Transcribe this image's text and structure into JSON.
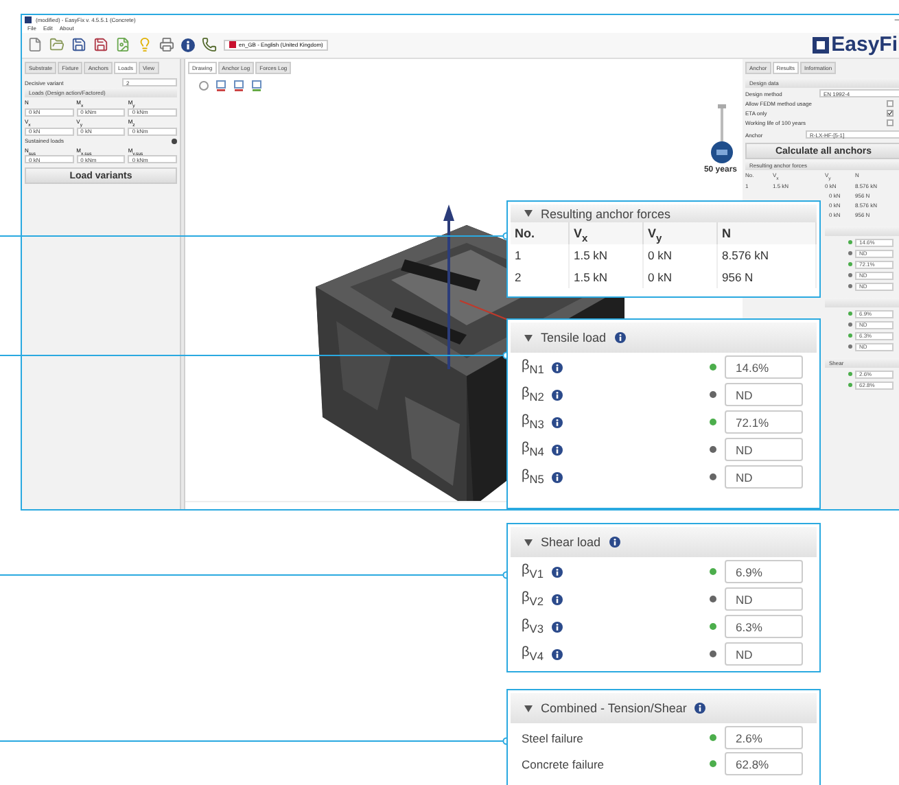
{
  "app": {
    "title": "(modified) - EasyFix v. 4.5.5.1 (Concrete)",
    "menu": [
      "File",
      "Edit",
      "About"
    ],
    "language": "en_GB - English (United Kingdom)",
    "logo": "EasyFi"
  },
  "left_panel": {
    "tabs": [
      {
        "label": "Substrate",
        "selected": false
      },
      {
        "label": "Fixture",
        "selected": false
      },
      {
        "label": "Anchors",
        "selected": false
      },
      {
        "label": "Loads",
        "selected": true
      },
      {
        "label": "View",
        "selected": false
      }
    ],
    "variant": {
      "label": "Decisive variant",
      "value": "2"
    },
    "section": "Loads (Design action/Factored)",
    "groups": [
      {
        "fields": [
          {
            "label": "N",
            "value": "0 kN"
          },
          {
            "label": "M$_{x}$",
            "value": "0 kNm"
          },
          {
            "label": "M$_{y}$",
            "value": "0 kNm"
          }
        ]
      },
      {
        "fields": [
          {
            "label": "V$_{x}$",
            "value": "0 kN"
          },
          {
            "label": "V$_{y}$",
            "value": "0 kN"
          },
          {
            "label": "M$_{z}$",
            "value": "0 kNm"
          }
        ]
      }
    ],
    "sustained": {
      "label": "Sustained loads",
      "fields": [
        {
          "label": "N$_{sus}$",
          "value": "0 kN"
        },
        {
          "label": "M$_{x,sus}$",
          "value": "0 kNm"
        },
        {
          "label": "M$_{y,sus}$",
          "value": "0 kNm"
        }
      ]
    },
    "button": "Load variants"
  },
  "center": {
    "tabs": [
      {
        "label": "Drawing",
        "selected": true
      },
      {
        "label": "Anchor Log",
        "selected": false
      },
      {
        "label": "Forces Log",
        "selected": false
      }
    ],
    "badge": "50 years"
  },
  "right_panel": {
    "tabs": [
      {
        "label": "Anchor",
        "selected": false
      },
      {
        "label": "Results",
        "selected": true
      },
      {
        "label": "Information",
        "selected": false
      }
    ],
    "section": "Design data",
    "method": {
      "label": "Design method",
      "value": "EN 1992-4"
    },
    "options": [
      {
        "label": "Allow FEDM method usage",
        "checked": false
      },
      {
        "label": "ETA only",
        "checked": true
      },
      {
        "label": "Working life of 100 years",
        "checked": false
      }
    ],
    "anchor": {
      "label": "Anchor",
      "value": "R-LX-HF-[5-1]"
    },
    "button": "Calculate all anchors",
    "forces": {
      "title": "Resulting anchor forces",
      "columns": [
        "No.",
        "V$_{x}$",
        "V$_{y}$",
        "N"
      ],
      "rows": [
        [
          "1",
          "1.5 kN",
          "0 kN",
          "8.576 kN"
        ],
        [
          "0 kN",
          "956 N"
        ],
        [
          "0 kN",
          "8.576 kN"
        ],
        [
          "0 kN",
          "956 N"
        ]
      ]
    },
    "results": [
      {
        "values": [
          {
            "ok": true,
            "value": "14.6%"
          },
          {
            "ok": false,
            "value": "ND"
          },
          {
            "ok": true,
            "value": "72.1%"
          },
          {
            "ok": false,
            "value": "ND"
          },
          {
            "ok": false,
            "value": "ND"
          }
        ]
      },
      {
        "values": [
          {
            "ok": true,
            "value": "6.9%"
          },
          {
            "ok": false,
            "value": "ND"
          },
          {
            "ok": true,
            "value": "6.3%"
          },
          {
            "ok": false,
            "value": "ND"
          }
        ]
      },
      {
        "title": "Shear",
        "values": [
          {
            "ok": true,
            "value": "2.6%"
          },
          {
            "ok": true,
            "value": "62.8%"
          }
        ]
      }
    ]
  },
  "callouts": [
    {
      "kind": "table",
      "title": "Resulting anchor forces",
      "columns": [
        "No.",
        "V$_{x}$",
        "V$_{y}$",
        "N"
      ],
      "rows": [
        [
          "1",
          "1.5 kN",
          "0 kN",
          "8.576 kN"
        ],
        [
          "2",
          "1.5 kN",
          "0 kN",
          "956 N"
        ]
      ]
    },
    {
      "kind": "checks",
      "title": "Tensile load",
      "rows": [
        {
          "label": "β$_{N1}$",
          "info": true,
          "ok": true,
          "value": "14.6%"
        },
        {
          "label": "β$_{N2}$",
          "info": true,
          "ok": false,
          "value": "ND"
        },
        {
          "label": "β$_{N3}$",
          "info": true,
          "ok": true,
          "value": "72.1%"
        },
        {
          "label": "β$_{N4}$",
          "info": true,
          "ok": false,
          "value": "ND"
        },
        {
          "label": "β$_{N5}$",
          "info": true,
          "ok": false,
          "value": "ND"
        }
      ]
    },
    {
      "kind": "checks",
      "title": "Shear load",
      "rows": [
        {
          "label": "β$_{V1}$",
          "info": true,
          "ok": true,
          "value": "6.9%"
        },
        {
          "label": "β$_{V2}$",
          "info": true,
          "ok": false,
          "value": "ND"
        },
        {
          "label": "β$_{V3}$",
          "info": true,
          "ok": true,
          "value": "6.3%"
        },
        {
          "label": "β$_{V4}$",
          "info": true,
          "ok": false,
          "value": "ND"
        }
      ]
    },
    {
      "kind": "checks",
      "title": "Combined - Tension/Shear",
      "rows": [
        {
          "label": "Steel failure",
          "info": false,
          "ok": true,
          "value": "2.6%"
        },
        {
          "label": "Concrete failure",
          "info": false,
          "ok": true,
          "value": "62.8%"
        }
      ]
    }
  ]
}
